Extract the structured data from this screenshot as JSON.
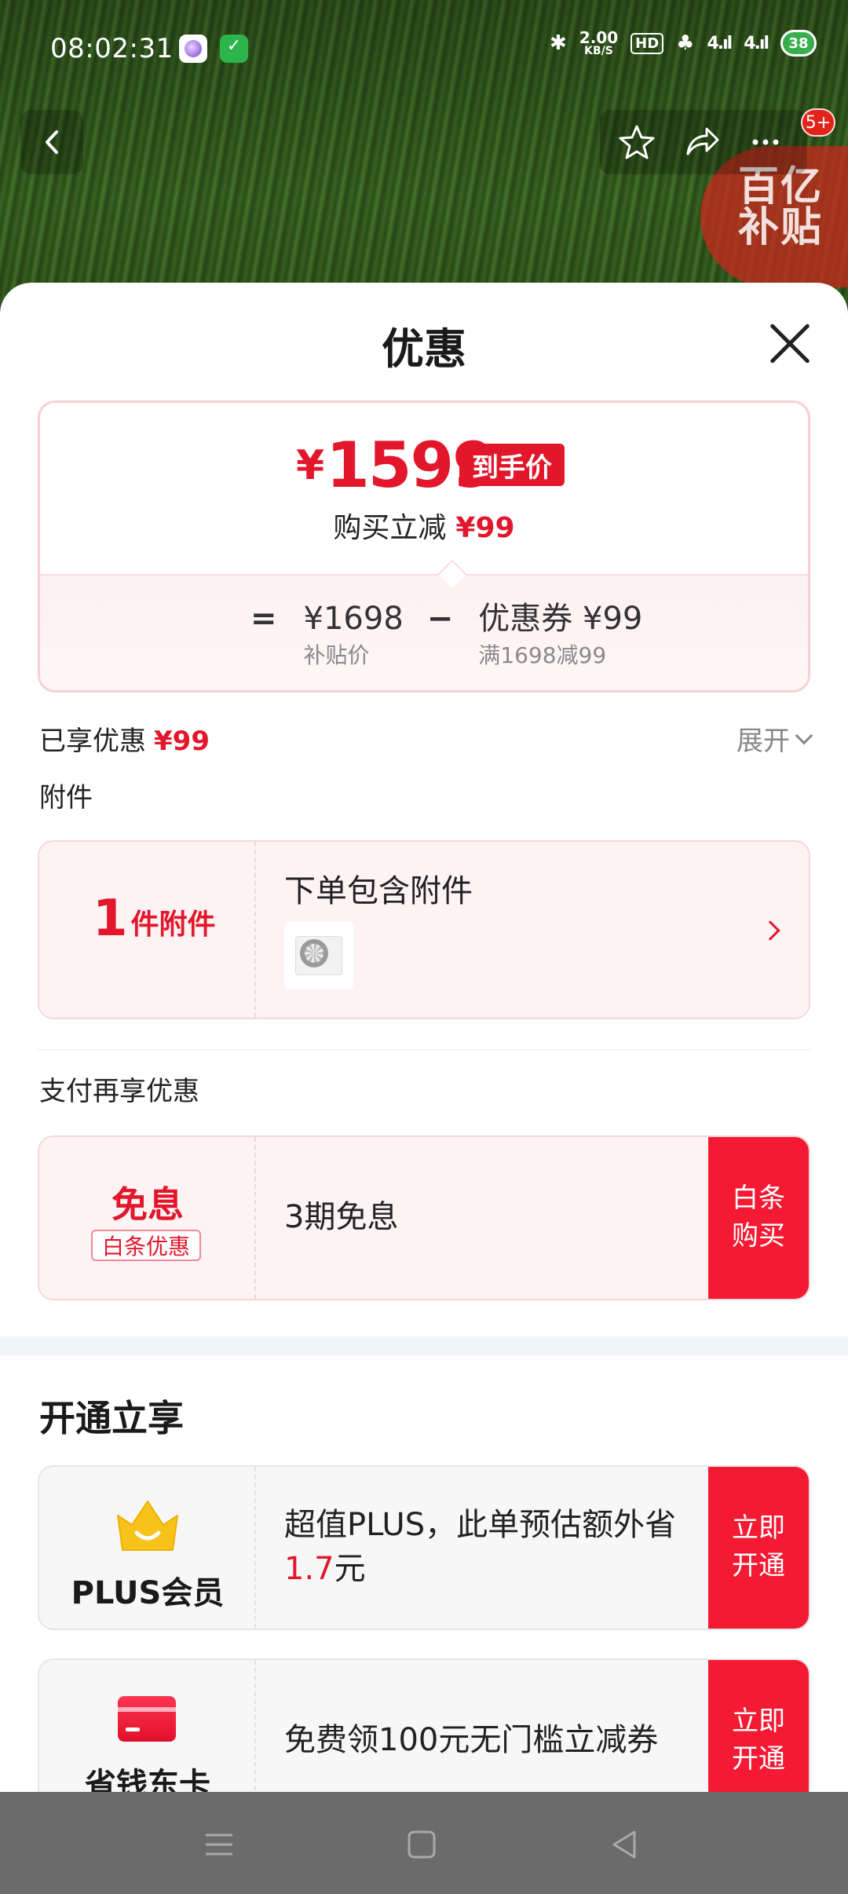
{
  "status_bar": {
    "time": "08:02:31",
    "speed_value": "2.00",
    "speed_unit": "KB/S",
    "hd": "HD",
    "signal1": "4",
    "signal2": "4",
    "battery": "38"
  },
  "header": {
    "subsidy_badge": "百亿\n补贴",
    "more_badge": "5+"
  },
  "sheet": {
    "title": "优惠",
    "price": {
      "currency": "¥",
      "final_amount": "1599",
      "final_tag": "到手价",
      "reduce_label": "购买立减",
      "reduce_amount": "¥99",
      "eq": "=",
      "base_value": "¥1698",
      "base_label": "补贴价",
      "minus": "−",
      "coupon_value": "优惠券 ¥99",
      "coupon_label": "满1698减99"
    },
    "enjoyed_label": "已享优惠",
    "enjoyed_amount": "¥99",
    "expand_label": "展开",
    "accessory": {
      "section": "附件",
      "count": "1",
      "count_unit": "件附件",
      "title": "下单包含附件"
    },
    "pay": {
      "section": "支付再享优惠",
      "main": "免息",
      "tag": "白条优惠",
      "text": "3期免息",
      "button": "白条\n购买"
    },
    "open": {
      "section": "开通立享",
      "plus": {
        "label": "PLUS会员",
        "text_pre": "超值PLUS，此单预估额外省",
        "text_amount": "1.7",
        "text_post": "元",
        "button": "立即\n开通"
      },
      "card": {
        "label": "省钱东卡",
        "text": "免费领100元无门槛立减券",
        "button": "立即\n开通"
      }
    }
  },
  "colors": {
    "accent_red": "#e3172c",
    "button_red": "#f51a33"
  }
}
